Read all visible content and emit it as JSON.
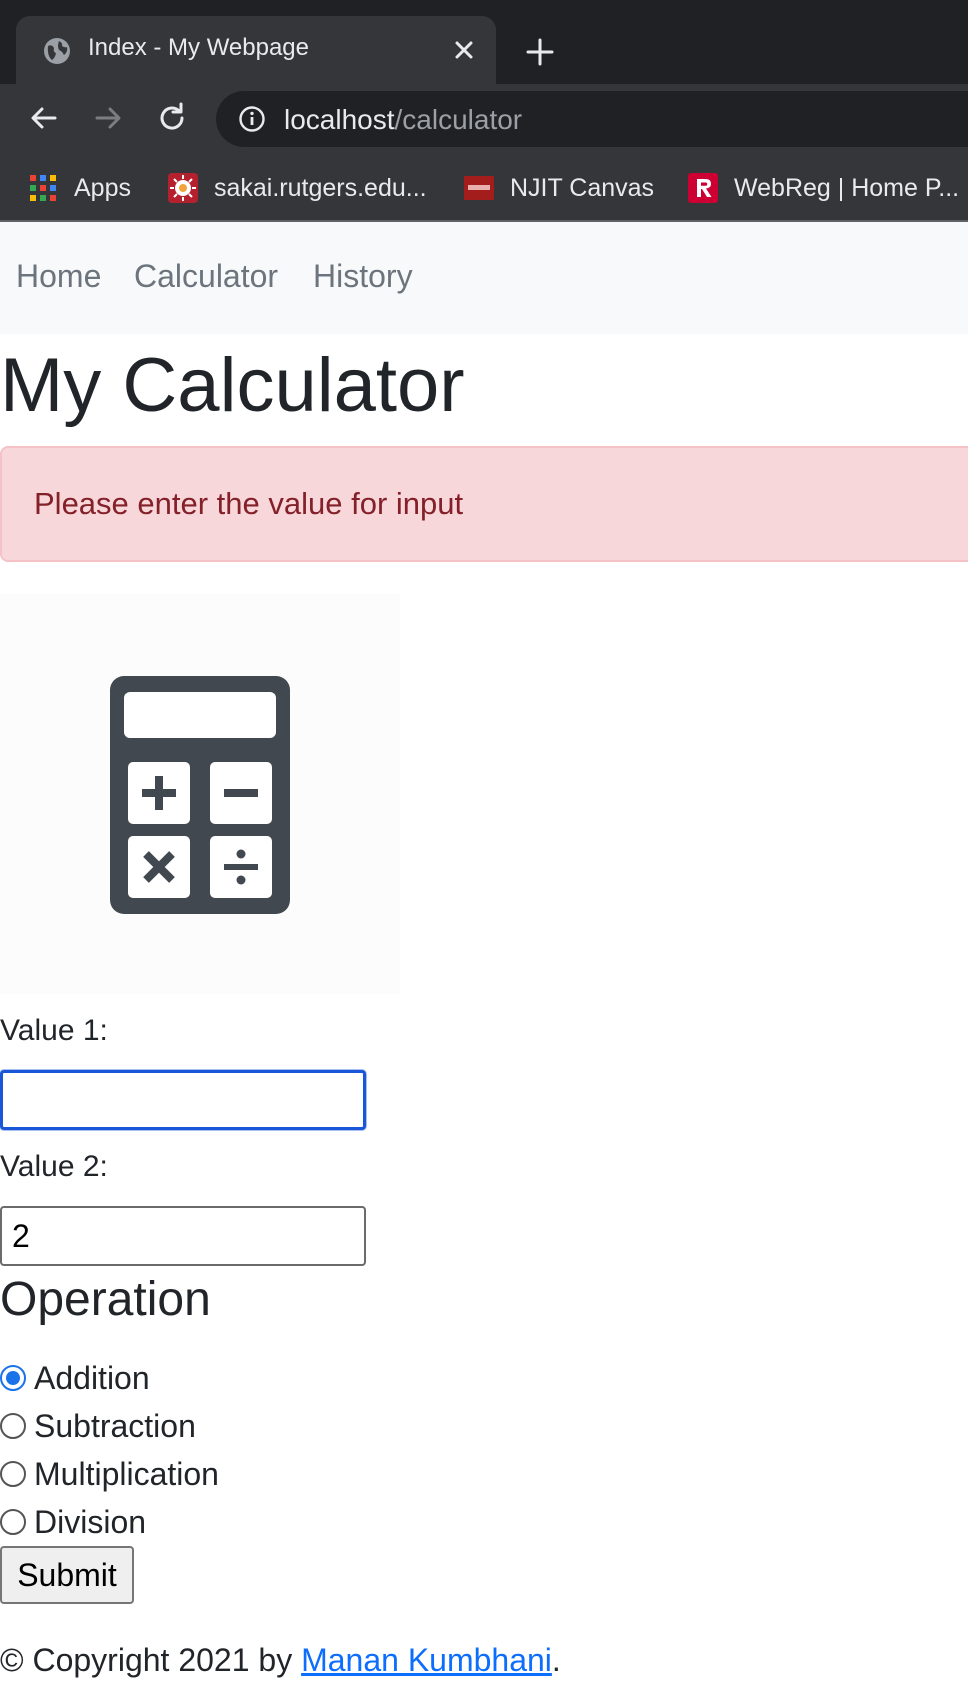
{
  "browser": {
    "tab_title": "Index - My Webpage",
    "url_host": "localhost",
    "url_path": "/calculator",
    "bookmarks": [
      {
        "label": "Apps",
        "icon": "apps-grid-icon"
      },
      {
        "label": "sakai.rutgers.edu...",
        "icon": "sakai-icon"
      },
      {
        "label": "NJIT Canvas",
        "icon": "njit-icon"
      },
      {
        "label": "WebReg | Home P...",
        "icon": "rutgers-r-icon"
      }
    ]
  },
  "nav": {
    "links": [
      "Home",
      "Calculator",
      "History"
    ]
  },
  "page": {
    "title": "My Calculator",
    "alert": "Please enter the value for input",
    "value1_label": "Value 1:",
    "value1": "",
    "value2_label": "Value 2:",
    "value2": "2",
    "operation_heading": "Operation",
    "operations": [
      {
        "label": "Addition",
        "checked": true
      },
      {
        "label": "Subtraction",
        "checked": false
      },
      {
        "label": "Multiplication",
        "checked": false
      },
      {
        "label": "Division",
        "checked": false
      }
    ],
    "selected_operation": "Addition",
    "submit_label": "Submit"
  },
  "footer": {
    "prefix": "© Copyright 2021 by ",
    "author": "Manan Kumbhani",
    "suffix": "."
  },
  "colors": {
    "accent": "#1a73e8",
    "link": "#0d6efd",
    "alert_bg": "#f8d7da",
    "alert_text": "#842029"
  }
}
